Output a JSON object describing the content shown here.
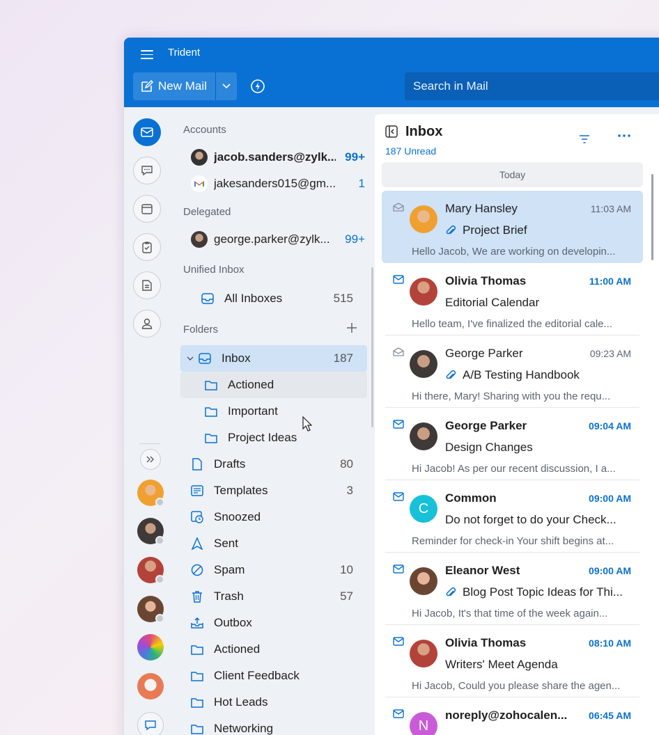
{
  "app": {
    "title": "Trident"
  },
  "toolbar": {
    "new_mail": "New Mail",
    "search_placeholder": "Search in Mail"
  },
  "rail": {
    "items": [
      "mail-icon",
      "chat-icon",
      "calendar-icon",
      "tasks-icon",
      "notes-icon",
      "contacts-icon"
    ],
    "expand": "expand-icon"
  },
  "accounts": {
    "header": "Accounts",
    "items": [
      {
        "email": "jacob.sanders@zylk...",
        "count": "99+",
        "bold": true
      },
      {
        "email": "jakesanders015@gm...",
        "count": "1",
        "bold": false
      }
    ]
  },
  "delegated": {
    "header": "Delegated",
    "items": [
      {
        "email": "george.parker@zylk...",
        "count": "99+"
      }
    ]
  },
  "unified": {
    "header": "Unified Inbox",
    "all_inboxes": "All Inboxes",
    "count": "515"
  },
  "folders": {
    "header": "Folders",
    "items": [
      {
        "name": "Inbox",
        "count": "187"
      },
      {
        "name": "Actioned",
        "count": ""
      },
      {
        "name": "Important",
        "count": ""
      },
      {
        "name": "Project Ideas",
        "count": ""
      },
      {
        "name": "Drafts",
        "count": "80"
      },
      {
        "name": "Templates",
        "count": "3"
      },
      {
        "name": "Snoozed",
        "count": ""
      },
      {
        "name": "Sent",
        "count": ""
      },
      {
        "name": "Spam",
        "count": "10"
      },
      {
        "name": "Trash",
        "count": "57"
      },
      {
        "name": "Outbox",
        "count": ""
      },
      {
        "name": "Actioned",
        "count": ""
      },
      {
        "name": "Client Feedback",
        "count": ""
      },
      {
        "name": "Hot Leads",
        "count": ""
      },
      {
        "name": "Networking",
        "count": ""
      }
    ]
  },
  "list": {
    "title": "Inbox",
    "unread": "187 Unread",
    "group": "Today",
    "messages": [
      {
        "sender": "Mary Hansley",
        "time": "11:03 AM",
        "subject": "Project Brief",
        "preview": "Hello Jacob, We are working on developin...",
        "unread": false,
        "attach": true
      },
      {
        "sender": "Olivia Thomas",
        "time": "11:00 AM",
        "subject": "Editorial Calendar",
        "preview": "Hello team, I've finalized the editorial cale...",
        "unread": true,
        "attach": false
      },
      {
        "sender": "George Parker",
        "time": "09:23 AM",
        "subject": "A/B Testing Handbook",
        "preview": "Hi there, Mary! Sharing with you the requ...",
        "unread": false,
        "attach": true
      },
      {
        "sender": "George Parker",
        "time": "09:04 AM",
        "subject": "Design Changes",
        "preview": "Hi Jacob! As per our recent discussion, I a...",
        "unread": true,
        "attach": false
      },
      {
        "sender": "Common",
        "time": "09:00 AM",
        "subject": "Do not forget to do your Check...",
        "preview": "Reminder for check-in Your shift begins at...",
        "unread": true,
        "attach": false,
        "initial": "C"
      },
      {
        "sender": "Eleanor West",
        "time": "09:00 AM",
        "subject": "Blog Post Topic Ideas for Thi...",
        "preview": "Hi Jacob, It's that time of the week again...",
        "unread": true,
        "attach": true
      },
      {
        "sender": "Olivia Thomas",
        "time": "08:10 AM",
        "subject": "Writers' Meet Agenda",
        "preview": "Hi Jacob, Could you please share the agen...",
        "unread": true,
        "attach": false
      },
      {
        "sender": "noreply@zohocalen...",
        "time": "06:45 AM",
        "subject": "",
        "preview": "",
        "unread": true,
        "attach": false,
        "initial": "N"
      }
    ]
  },
  "colors": {
    "accent": "#0a71d4",
    "titlebar": "#0a71d4",
    "selected": "#cfe2f6",
    "common_avatar": "#17c1d8",
    "noreply_avatar": "#c95bd8"
  }
}
